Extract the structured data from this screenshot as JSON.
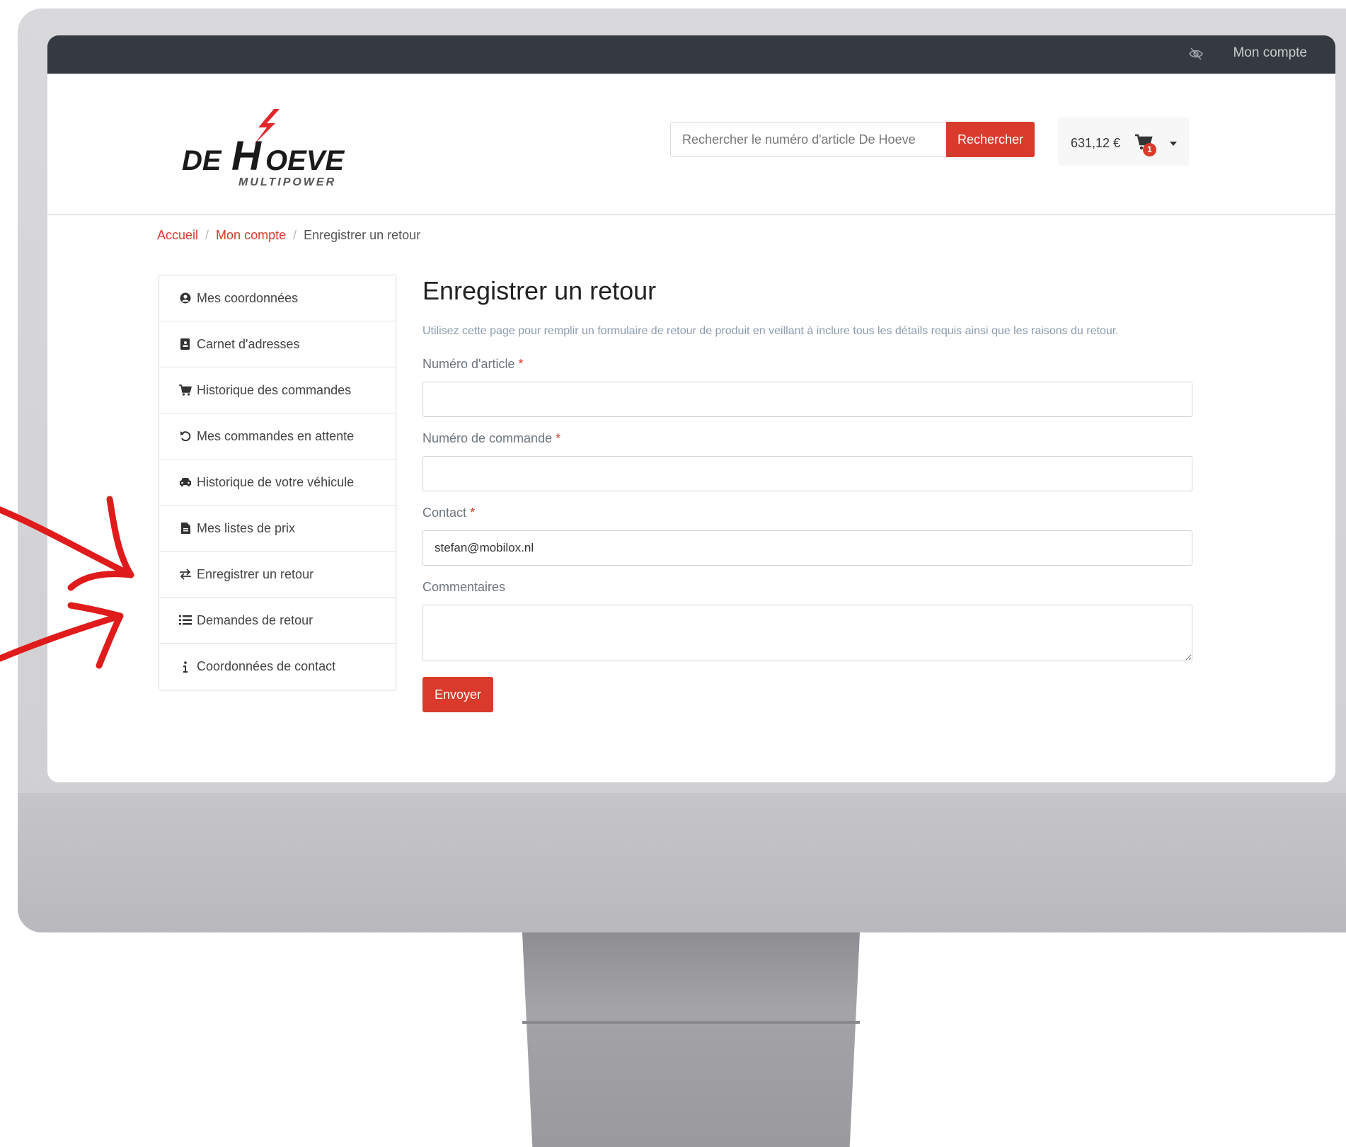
{
  "topbar": {
    "account_label": "Mon compte",
    "eye_icon": "eye-slash-icon"
  },
  "header": {
    "logo": {
      "line1": "DE HOEVE",
      "line2": "MULTIPOWER"
    },
    "search": {
      "placeholder": "Rechercher le numéro d'article De Hoeve",
      "button_label": "Rechercher"
    },
    "cart": {
      "total": "631,12 €",
      "badge_count": "1",
      "icon": "cart-icon"
    }
  },
  "breadcrumb": {
    "items": [
      "Accueil",
      "Mon compte",
      "Enregistrer un retour"
    ],
    "separator": "/"
  },
  "sidebar": {
    "items": [
      {
        "label": "Mes coordonnées",
        "icon": "user-circle-icon"
      },
      {
        "label": "Carnet d'adresses",
        "icon": "address-book-icon"
      },
      {
        "label": "Historique des commandes",
        "icon": "cart-icon"
      },
      {
        "label": "Mes commandes en attente",
        "icon": "undo-icon"
      },
      {
        "label": "Historique de votre véhicule",
        "icon": "car-icon"
      },
      {
        "label": "Mes listes de prix",
        "icon": "file-icon"
      },
      {
        "label": "Enregistrer un retour",
        "icon": "exchange-icon"
      },
      {
        "label": "Demandes de retour",
        "icon": "list-icon"
      },
      {
        "label": "Coordonnées de contact",
        "icon": "info-icon"
      }
    ]
  },
  "main": {
    "title": "Enregistrer un retour",
    "intro": "Utilisez cette page pour remplir un formulaire de retour de produit en veillant à inclure tous les détails requis ainsi que les raisons du retour.",
    "fields": {
      "article": {
        "label": "Numéro d'article",
        "required_mark": "*",
        "value": ""
      },
      "order": {
        "label": "Numéro de commande",
        "required_mark": "*",
        "value": ""
      },
      "contact": {
        "label": "Contact",
        "required_mark": "*",
        "value": "stefan@mobilox.nl"
      },
      "comments": {
        "label": "Commentaires",
        "value": ""
      }
    },
    "submit_label": "Envoyer"
  },
  "colors": {
    "accent": "#d93a2b",
    "topbar": "#343a40",
    "annotation_arrows": "#e01b1b"
  }
}
